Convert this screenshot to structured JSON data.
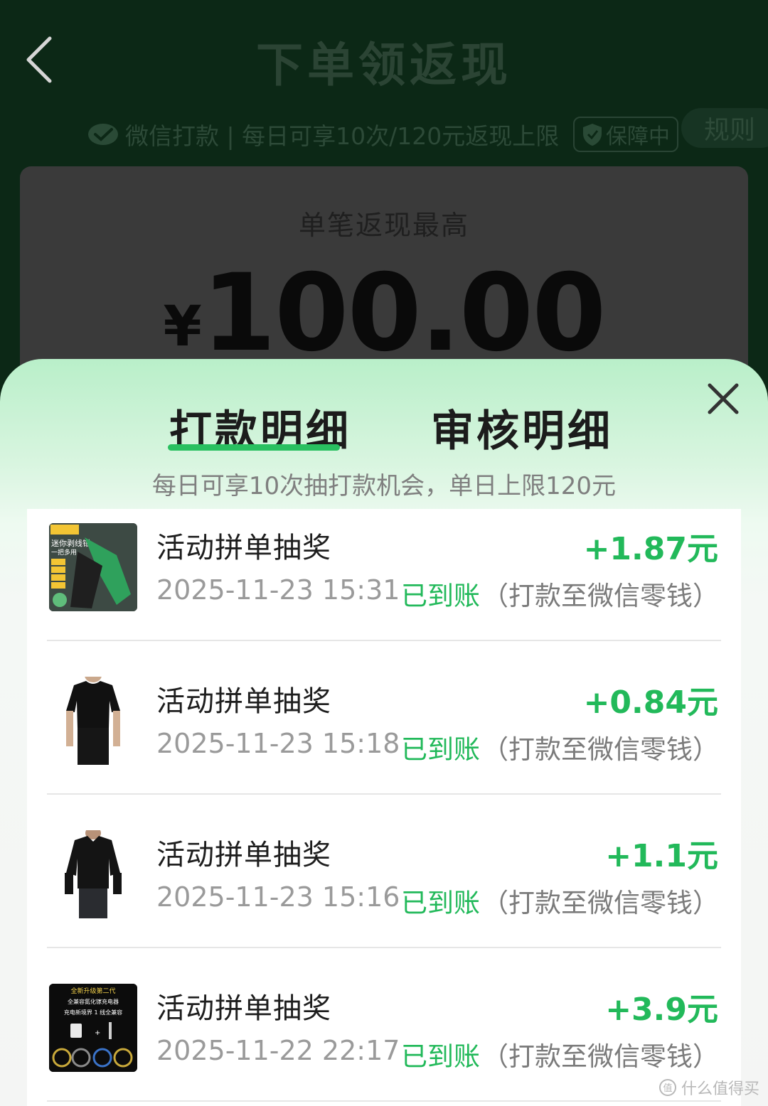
{
  "header": {
    "title": "下单领返现",
    "subline": "微信打款 | 每日可享10次/120元返现上限",
    "guard_badge": "保障中",
    "rules_button": "规则"
  },
  "max_card": {
    "label": "单笔返现最高",
    "currency": "¥",
    "amount": "100.00"
  },
  "sheet": {
    "tabs": [
      {
        "label": "打款明细",
        "active": true
      },
      {
        "label": "审核明细",
        "active": false
      }
    ],
    "note": "每日可享10次抽打款机会，单日上限120元",
    "accent_color": "#22b95a",
    "items": [
      {
        "title": "活动拼单抽奖",
        "time": "2025-11-23 15:31",
        "amount": "+1.87元",
        "status": "已到账",
        "status_note": "（打款至微信零钱）",
        "thumb": "wire-stripper-product-image",
        "thumb_text": [
          "迷你剥线钳",
          "一把多用"
        ]
      },
      {
        "title": "活动拼单抽奖",
        "time": "2025-11-23 15:18",
        "amount": "+0.84元",
        "status": "已到账",
        "status_note": "（打款至微信零钱）",
        "thumb": "black-tshirt-product-image"
      },
      {
        "title": "活动拼单抽奖",
        "time": "2025-11-23 15:16",
        "amount": "+1.1元",
        "status": "已到账",
        "status_note": "（打款至微信零钱）",
        "thumb": "black-polo-product-image"
      },
      {
        "title": "活动拼单抽奖",
        "time": "2025-11-22 22:17",
        "amount": "+3.9元",
        "status": "已到账",
        "status_note": "（打款至微信零钱）",
        "thumb": "charger-product-image",
        "thumb_text": [
          "全新升级第二代",
          "全兼容氮化镓充电器",
          "充电新境界 1 线全兼容"
        ]
      }
    ]
  },
  "watermark": "什么值得买"
}
